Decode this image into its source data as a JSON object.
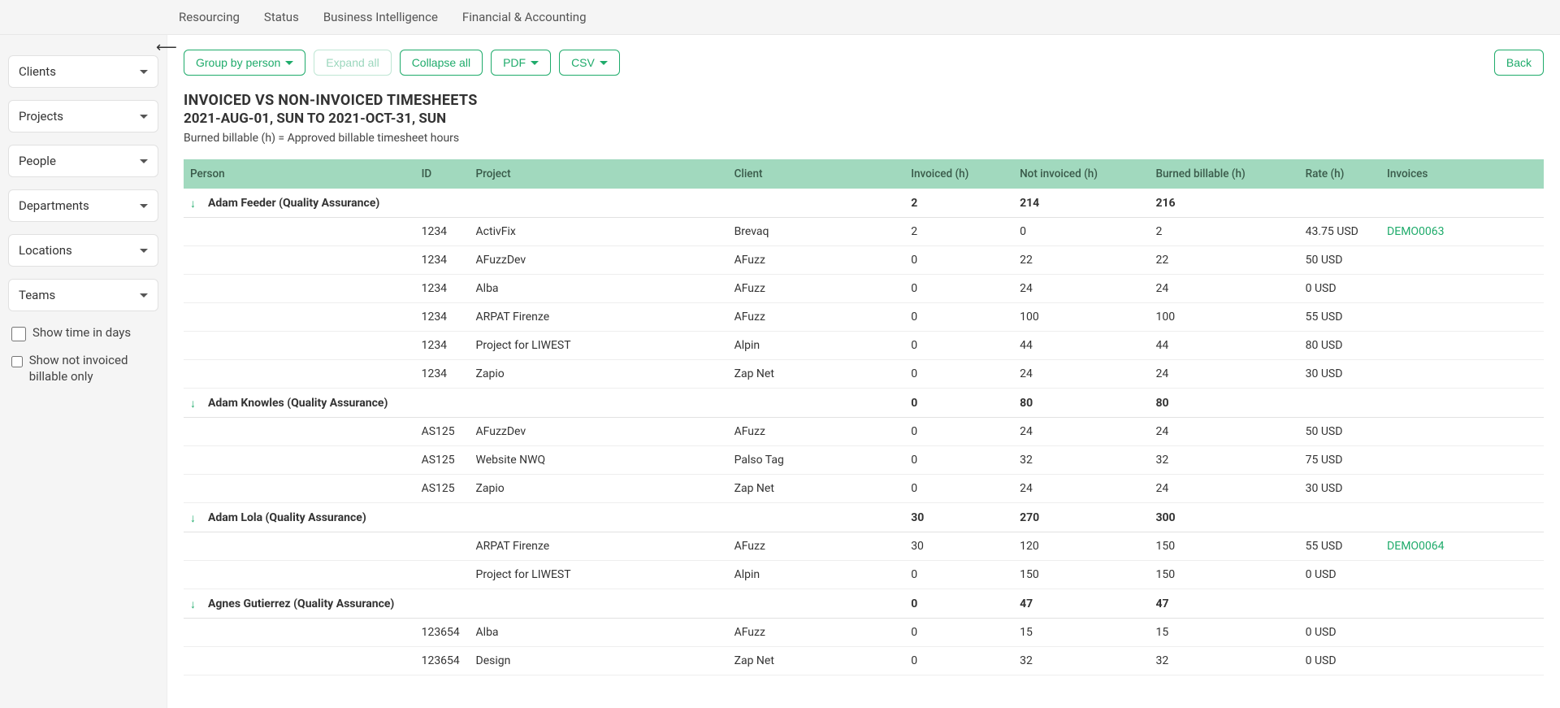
{
  "topnav": [
    "Resourcing",
    "Status",
    "Business Intelligence",
    "Financial & Accounting"
  ],
  "sidebar": {
    "filters": [
      "Clients",
      "Projects",
      "People",
      "Departments",
      "Locations",
      "Teams"
    ],
    "checkboxes": [
      {
        "label": "Show time in days",
        "checked": false
      },
      {
        "label": "Show not invoiced billable only",
        "checked": false
      }
    ]
  },
  "toolbar": {
    "group_by": "Group by person",
    "expand_all": "Expand all",
    "collapse_all": "Collapse all",
    "pdf": "PDF",
    "csv": "CSV",
    "back": "Back"
  },
  "report": {
    "title": "INVOICED VS NON-INVOICED TIMESHEETS",
    "range": "2021-AUG-01, SUN TO 2021-OCT-31, SUN",
    "note": "Burned billable (h) = Approved billable timesheet hours"
  },
  "table": {
    "headers": [
      "Person",
      "ID",
      "Project",
      "Client",
      "Invoiced (h)",
      "Not invoiced (h)",
      "Burned billable (h)",
      "Rate (h)",
      "Invoices"
    ],
    "groups": [
      {
        "person": "Adam Feeder (Quality Assurance)",
        "invoiced": "2",
        "not_invoiced": "214",
        "burned": "216",
        "rows": [
          {
            "id": "1234",
            "project": "ActivFix",
            "client": "Brevaq",
            "invoiced": "2",
            "not_invoiced": "0",
            "burned": "2",
            "rate": "43.75 USD",
            "invoice": "DEMO0063"
          },
          {
            "id": "1234",
            "project": "AFuzzDev",
            "client": "AFuzz",
            "invoiced": "0",
            "not_invoiced": "22",
            "burned": "22",
            "rate": "50 USD",
            "invoice": ""
          },
          {
            "id": "1234",
            "project": "Alba",
            "client": "AFuzz",
            "invoiced": "0",
            "not_invoiced": "24",
            "burned": "24",
            "rate": "0 USD",
            "invoice": ""
          },
          {
            "id": "1234",
            "project": "ARPAT Firenze",
            "client": "AFuzz",
            "invoiced": "0",
            "not_invoiced": "100",
            "burned": "100",
            "rate": "55 USD",
            "invoice": ""
          },
          {
            "id": "1234",
            "project": "Project for LIWEST",
            "client": "Alpin",
            "invoiced": "0",
            "not_invoiced": "44",
            "burned": "44",
            "rate": "80 USD",
            "invoice": ""
          },
          {
            "id": "1234",
            "project": "Zapio",
            "client": "Zap Net",
            "invoiced": "0",
            "not_invoiced": "24",
            "burned": "24",
            "rate": "30 USD",
            "invoice": ""
          }
        ]
      },
      {
        "person": "Adam Knowles (Quality Assurance)",
        "invoiced": "0",
        "not_invoiced": "80",
        "burned": "80",
        "rows": [
          {
            "id": "AS125",
            "project": "AFuzzDev",
            "client": "AFuzz",
            "invoiced": "0",
            "not_invoiced": "24",
            "burned": "24",
            "rate": "50 USD",
            "invoice": ""
          },
          {
            "id": "AS125",
            "project": "Website NWQ",
            "client": "Palso Tag",
            "invoiced": "0",
            "not_invoiced": "32",
            "burned": "32",
            "rate": "75 USD",
            "invoice": ""
          },
          {
            "id": "AS125",
            "project": "Zapio",
            "client": "Zap Net",
            "invoiced": "0",
            "not_invoiced": "24",
            "burned": "24",
            "rate": "30 USD",
            "invoice": ""
          }
        ]
      },
      {
        "person": "Adam Lola (Quality Assurance)",
        "invoiced": "30",
        "not_invoiced": "270",
        "burned": "300",
        "rows": [
          {
            "id": "",
            "project": "ARPAT Firenze",
            "client": "AFuzz",
            "invoiced": "30",
            "not_invoiced": "120",
            "burned": "150",
            "rate": "55 USD",
            "invoice": "DEMO0064"
          },
          {
            "id": "",
            "project": "Project for LIWEST",
            "client": "Alpin",
            "invoiced": "0",
            "not_invoiced": "150",
            "burned": "150",
            "rate": "0 USD",
            "invoice": ""
          }
        ]
      },
      {
        "person": "Agnes Gutierrez (Quality Assurance)",
        "invoiced": "0",
        "not_invoiced": "47",
        "burned": "47",
        "rows": [
          {
            "id": "123654",
            "project": "Alba",
            "client": "AFuzz",
            "invoiced": "0",
            "not_invoiced": "15",
            "burned": "15",
            "rate": "0 USD",
            "invoice": ""
          },
          {
            "id": "123654",
            "project": "Design",
            "client": "Zap Net",
            "invoiced": "0",
            "not_invoiced": "32",
            "burned": "32",
            "rate": "0 USD",
            "invoice": ""
          }
        ]
      }
    ]
  }
}
